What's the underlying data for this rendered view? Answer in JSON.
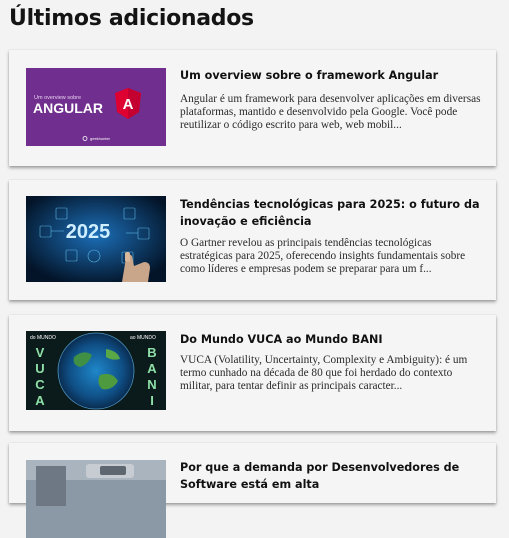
{
  "section": {
    "title": "Últimos adicionados"
  },
  "articles": [
    {
      "title": "Um overview sobre o framework Angular",
      "excerpt": "Angular é um framework para desenvolver aplicações em diversas plataformas, mantido e desenvolvido pela Google. Você pode reutilizar o código escrito para web, web mobil...",
      "thumb": {
        "icon": "angular-logo",
        "small_text": "Um overview sobre",
        "big_text": "ANGULAR",
        "logo_letter": "A",
        "brand": "geekhunter",
        "bg": "#6a2c8c"
      }
    },
    {
      "title": "Tendências tecnológicas para 2025: o futuro da inovação e eficiência",
      "excerpt": "O Gartner revelou as principais tendências tecnológicas estratégicas para 2025, oferecendo insights fundamentais sobre como líderes e empresas podem se preparar para um f...",
      "thumb": {
        "icon": "tech-2025-hologram",
        "big_text": "2025",
        "bg": "#041d3a"
      }
    },
    {
      "title": "Do Mundo VUCA ao Mundo BANI",
      "excerpt": "VUCA (Volatility, Uncertainty, Complexity e Ambiguity): é um termo cunhado na década de 80 que foi herdado do contexto militar, para tentar definir as principais caracter...",
      "thumb": {
        "icon": "globe-vuca-bani",
        "left_caption": "do MUNDO",
        "right_caption": "ao MUNDO",
        "left_word": [
          "V",
          "U",
          "C",
          "A"
        ],
        "right_word": [
          "B",
          "A",
          "N",
          "I"
        ],
        "bg": "#0b1a1a"
      }
    },
    {
      "title": "Por que a demanda por Desenvolvedores de Software está em alta",
      "excerpt": "",
      "thumb": {
        "icon": "developer-photo",
        "bg": "#8b98a6"
      }
    }
  ]
}
